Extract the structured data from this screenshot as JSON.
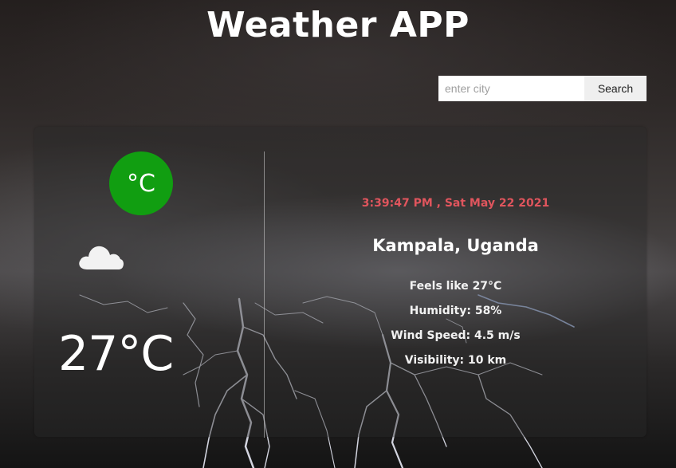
{
  "app": {
    "title": "Weather APP"
  },
  "search": {
    "placeholder": "enter city",
    "value": "",
    "button_label": "Search"
  },
  "weather": {
    "unit_toggle_label": "°C",
    "condition_icon": "cloud-icon",
    "temperature": "27°C",
    "datetime": "3:39:47 PM , Sat May 22 2021",
    "location": "Kampala, Uganda",
    "details": {
      "feels_like": "Feels like 27°C",
      "humidity": "Humidity: 58%",
      "wind_speed": "Wind Speed: 4.5 m/s",
      "visibility": "Visibility: 10 km"
    }
  },
  "colors": {
    "unit_toggle_bg": "#119e11",
    "datetime_text": "#e0555d",
    "card_bg": "rgba(40,40,40,0.42)"
  }
}
